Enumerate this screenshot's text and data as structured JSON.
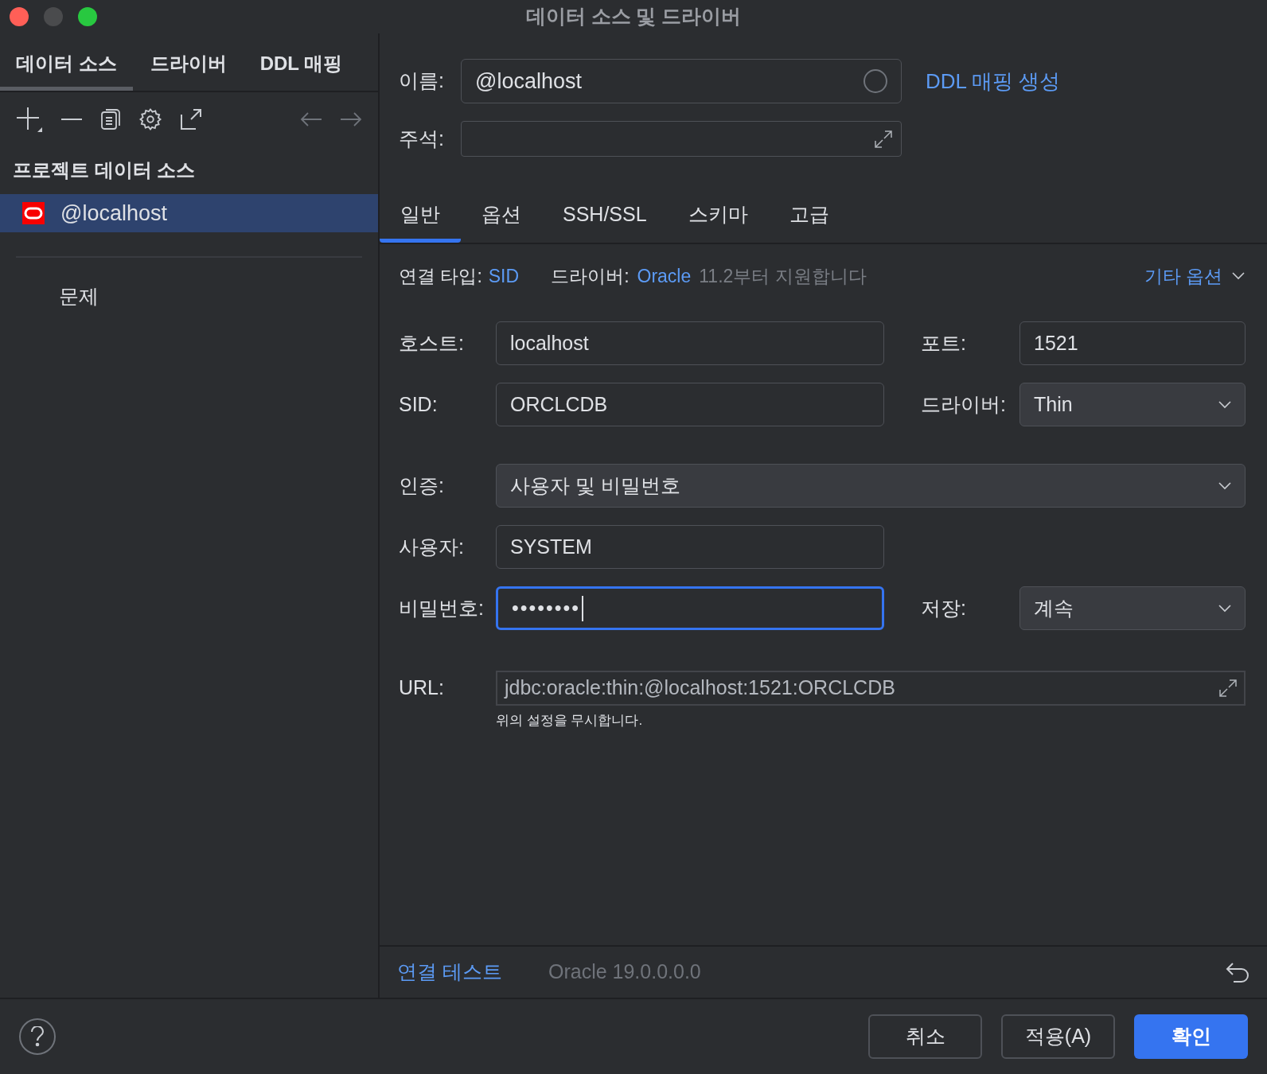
{
  "window": {
    "title": "데이터 소스 및 드라이버"
  },
  "left_tabs": [
    {
      "label": "데이터 소스",
      "selected": true
    },
    {
      "label": "드라이버",
      "selected": false
    },
    {
      "label": "DDL 매핑",
      "selected": false
    }
  ],
  "sidebar": {
    "section_title": "프로젝트 데이터 소스",
    "items": [
      {
        "label": "@localhost",
        "selected": true
      }
    ],
    "problems": "문제"
  },
  "name_field": {
    "label": "이름:",
    "value": "@localhost"
  },
  "create_ddl_link": "DDL 매핑 생성",
  "comment_field": {
    "label": "주석:"
  },
  "tabs": [
    {
      "label": "일반",
      "selected": true
    },
    {
      "label": "옵션",
      "selected": false
    },
    {
      "label": "SSH/SSL",
      "selected": false
    },
    {
      "label": "스키마",
      "selected": false
    },
    {
      "label": "고급",
      "selected": false
    }
  ],
  "connection_info": {
    "type_label": "연결 타입:",
    "type_value": "SID",
    "driver_label": "드라이버:",
    "driver_value": "Oracle",
    "driver_note": "11.2부터 지원합니다",
    "more_options": "기타 옵션"
  },
  "rows": [
    {
      "left": {
        "label": "호스트:",
        "value": "localhost",
        "kind": "input",
        "focused": false
      },
      "right": {
        "label": "포트:",
        "value": "1521",
        "kind": "input"
      }
    },
    {
      "left": {
        "label": "SID:",
        "value": "ORCLCDB",
        "kind": "input",
        "focused": false
      },
      "right": {
        "label": "드라이버:",
        "value": "Thin",
        "kind": "select"
      }
    },
    {
      "full": {
        "label": "인증:",
        "value": "사용자 및 비밀번호",
        "kind": "select"
      }
    },
    {
      "left": {
        "label": "사용자:",
        "value": "SYSTEM",
        "kind": "input",
        "focused": false
      }
    },
    {
      "left": {
        "label": "비밀번호:",
        "value": "••••••••",
        "kind": "password",
        "focused": true
      },
      "right": {
        "label": "저장:",
        "value": "계속",
        "kind": "select"
      }
    }
  ],
  "url_field": {
    "label": "URL:",
    "value": "jdbc:oracle:thin:@localhost:1521:ORCLCDB",
    "note": "위의 설정을 무시합니다."
  },
  "footer": {
    "test_link": "연결 테스트",
    "version": "Oracle 19.0.0.0.0"
  },
  "buttons": [
    {
      "label": "취소",
      "primary": false
    },
    {
      "label": "적용(A)",
      "primary": false
    },
    {
      "label": "확인",
      "primary": true
    }
  ]
}
